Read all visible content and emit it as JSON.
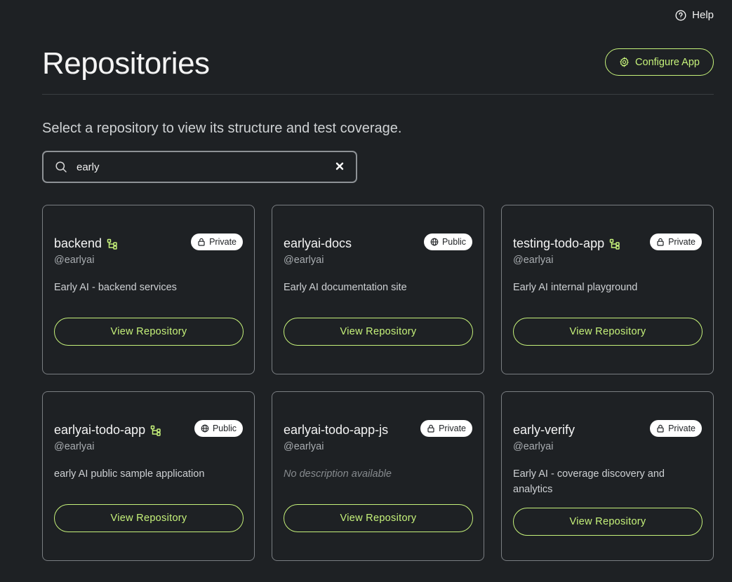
{
  "header": {
    "help_label": "Help",
    "title": "Repositories",
    "configure_label": "Configure App"
  },
  "subtitle": "Select a repository to view its structure and test coverage.",
  "search": {
    "value": "early"
  },
  "colors": {
    "accent": "#c6f27a",
    "background": "#1e2124",
    "card_border": "#7a7e82"
  },
  "repos": [
    {
      "name": "backend",
      "owner": "@earlyai",
      "visibility": "Private",
      "description": "Early AI - backend services",
      "has_tree_icon": true,
      "button": "View Repository"
    },
    {
      "name": "earlyai-docs",
      "owner": "@earlyai",
      "visibility": "Public",
      "description": "Early AI documentation site",
      "has_tree_icon": false,
      "button": "View Repository"
    },
    {
      "name": "testing-todo-app",
      "owner": "@earlyai",
      "visibility": "Private",
      "description": "Early AI internal playground",
      "has_tree_icon": true,
      "button": "View Repository"
    },
    {
      "name": "earlyai-todo-app",
      "owner": "@earlyai",
      "visibility": "Public",
      "description": "early AI public sample application",
      "has_tree_icon": true,
      "button": "View Repository"
    },
    {
      "name": "earlyai-todo-app-js",
      "owner": "@earlyai",
      "visibility": "Private",
      "description": "No description available",
      "has_tree_icon": false,
      "button": "View Repository"
    },
    {
      "name": "early-verify",
      "owner": "@earlyai",
      "visibility": "Private",
      "description": "Early AI - coverage discovery and analytics",
      "has_tree_icon": false,
      "button": "View Repository"
    }
  ]
}
